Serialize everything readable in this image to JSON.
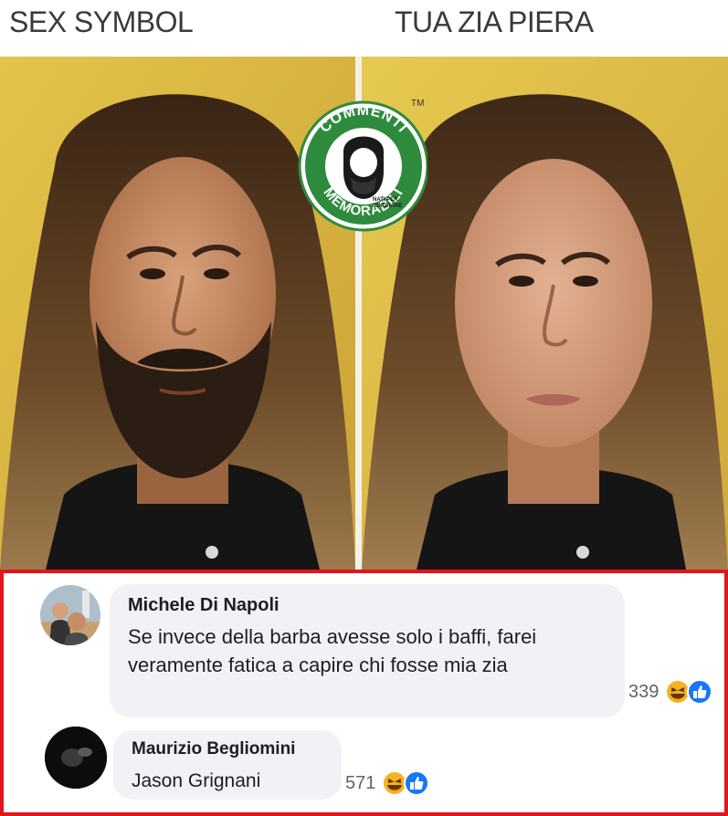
{
  "meme": {
    "left_caption": "SEX SYMBOL",
    "right_caption": "TUA ZIA PIERA",
    "logo": {
      "top_text": "COMMENTI",
      "bottom_text": "MEMORABILI",
      "tagline_line1": "NATI PER",
      "tagline_line2": "IGNORARE",
      "trademark": "TM",
      "color": "#2e8b3e"
    }
  },
  "comments": [
    {
      "author": "Michele Di Napoli",
      "text": "Se invece della barba avesse solo i baffi, farei veramente fatica a capire chi fosse mia zia",
      "reaction_count": "339",
      "reactions": [
        "haha-icon",
        "like-icon"
      ]
    },
    {
      "author": "Maurizio Begliomini",
      "text": "Jason Grignani",
      "reaction_count": "571",
      "reactions": [
        "haha-icon",
        "like-icon"
      ]
    }
  ],
  "colors": {
    "highlight_border": "#e3141b",
    "bubble": "#f0f2f5",
    "like_blue": "#1877f2",
    "haha_yellow": "#f7b125"
  }
}
